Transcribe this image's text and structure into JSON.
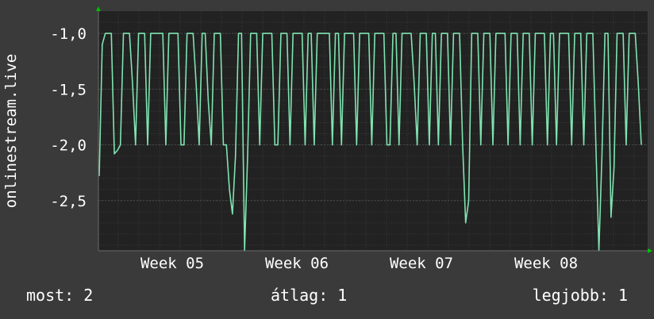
{
  "chart_data": {
    "type": "line",
    "ylabel": "onlinestream.live",
    "y_ticks": [
      {
        "value": -1.0,
        "label": "-1,0"
      },
      {
        "value": -1.5,
        "label": "-1,5"
      },
      {
        "value": -2.0,
        "label": "-2,0"
      },
      {
        "value": -2.5,
        "label": "-2,5"
      }
    ],
    "x_ticks": [
      "Week 05",
      "Week 06",
      "Week 07",
      "Week 08"
    ],
    "ylim": [
      -2.95,
      -0.8
    ],
    "grid": true,
    "colors": {
      "background": "#3a3a3a",
      "plot_background": "#222222",
      "grid": "#4a4a4a",
      "line": "#7fe3b0",
      "axis_arrow": "#00c000"
    },
    "series": [
      {
        "values": [
          -2.28,
          -1.1,
          -1.0,
          -1.0,
          -1.0,
          -2.08,
          -2.05,
          -2.0,
          -1.0,
          -1.0,
          -1.0,
          -1.45,
          -2.0,
          -1.0,
          -1.0,
          -1.0,
          -2.0,
          -1.0,
          -1.0,
          -1.0,
          -1.0,
          -1.0,
          -2.0,
          -1.0,
          -1.0,
          -1.0,
          -1.0,
          -2.0,
          -2.0,
          -1.0,
          -1.0,
          -1.0,
          -1.45,
          -2.0,
          -1.0,
          -1.0,
          -1.6,
          -2.0,
          -1.0,
          -1.0,
          -1.0,
          -2.0,
          -2.0,
          -2.4,
          -2.62,
          -2.1,
          -1.0,
          -1.0,
          -2.95,
          -2.1,
          -1.0,
          -1.0,
          -1.0,
          -2.0,
          -1.0,
          -1.0,
          -1.0,
          -1.0,
          -2.0,
          -2.0,
          -1.0,
          -1.0,
          -1.0,
          -2.0,
          -1.0,
          -1.0,
          -1.0,
          -1.0,
          -2.0,
          -1.0,
          -1.0,
          -2.0,
          -1.0,
          -1.0,
          -1.0,
          -1.0,
          -1.0,
          -2.0,
          -1.0,
          -1.0,
          -2.0,
          -1.0,
          -1.0,
          -1.0,
          -1.0,
          -2.0,
          -1.0,
          -1.0,
          -1.0,
          -1.0,
          -2.0,
          -1.0,
          -1.0,
          -1.0,
          -1.0,
          -2.0,
          -2.0,
          -1.0,
          -1.0,
          -2.0,
          -1.0,
          -1.0,
          -1.0,
          -1.0,
          -1.45,
          -2.0,
          -1.0,
          -1.0,
          -1.0,
          -2.0,
          -1.0,
          -1.0,
          -2.0,
          -1.0,
          -1.0,
          -1.0,
          -2.0,
          -1.0,
          -1.0,
          -1.0,
          -2.0,
          -2.7,
          -2.5,
          -1.0,
          -1.0,
          -1.0,
          -2.0,
          -1.0,
          -1.0,
          -1.0,
          -2.0,
          -1.0,
          -1.0,
          -1.0,
          -1.0,
          -2.0,
          -1.0,
          -1.0,
          -1.0,
          -2.0,
          -1.0,
          -1.0,
          -1.0,
          -2.0,
          -1.0,
          -1.0,
          -1.0,
          -1.0,
          -2.0,
          -1.0,
          -1.0,
          -2.0,
          -1.0,
          -1.0,
          -1.0,
          -1.0,
          -2.0,
          -1.0,
          -1.0,
          -1.0,
          -2.0,
          -1.0,
          -1.0,
          -1.0,
          -2.0,
          -2.95,
          -2.1,
          -1.0,
          -1.0,
          -2.65,
          -2.2,
          -1.0,
          -1.0,
          -1.0,
          -2.0,
          -1.0,
          -1.0,
          -1.0,
          -1.45,
          -2.0
        ]
      }
    ]
  },
  "stats": {
    "now": "most: 2",
    "average": "átlag: 1",
    "best": "legjobb: 1"
  }
}
